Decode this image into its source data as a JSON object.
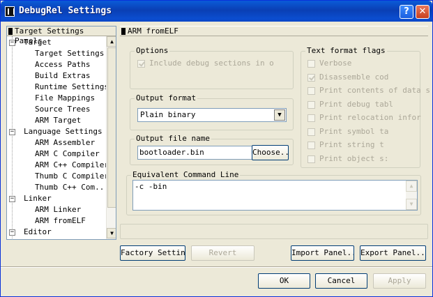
{
  "window": {
    "title": "DebugRel Settings"
  },
  "titlebar": {
    "help": "?",
    "close": "✕"
  },
  "tree": {
    "header": "Target Settings Panels",
    "items": [
      {
        "label": "Target",
        "level": 0,
        "expander": "−"
      },
      {
        "label": "Target Settings",
        "level": 1
      },
      {
        "label": "Access Paths",
        "level": 1
      },
      {
        "label": "Build Extras",
        "level": 1
      },
      {
        "label": "Runtime Settings",
        "level": 1
      },
      {
        "label": "File Mappings",
        "level": 1
      },
      {
        "label": "Source Trees",
        "level": 1
      },
      {
        "label": "ARM Target",
        "level": 1
      },
      {
        "label": "Language Settings",
        "level": 0,
        "expander": "−"
      },
      {
        "label": "ARM Assembler",
        "level": 1
      },
      {
        "label": "ARM C Compiler",
        "level": 1
      },
      {
        "label": "ARM C++ Compiler",
        "level": 1
      },
      {
        "label": "Thumb C Compiler",
        "level": 1
      },
      {
        "label": "Thumb C++ Com...",
        "level": 1
      },
      {
        "label": "Linker",
        "level": 0,
        "expander": "−"
      },
      {
        "label": "ARM Linker",
        "level": 1
      },
      {
        "label": "ARM fromELF",
        "level": 1
      },
      {
        "label": "Editor",
        "level": 0,
        "expander": "−"
      }
    ]
  },
  "panel": {
    "title": "ARM fromELF",
    "options": {
      "label": "Options",
      "include_debug": {
        "label": "Include debug sections in o",
        "checked": true
      }
    },
    "output_format": {
      "label": "Output format",
      "value": "Plain binary"
    },
    "output_file": {
      "label": "Output file name",
      "value": "bootloader.bin",
      "choose_label": "Choose..."
    },
    "text_flags": {
      "label": "Text format flags",
      "items": [
        {
          "label": "Verbose",
          "checked": false
        },
        {
          "label": "Disassemble cod",
          "checked": true
        },
        {
          "label": "Print contents of data s",
          "checked": false
        },
        {
          "label": "Print debug tabl",
          "checked": false
        },
        {
          "label": "Print relocation infor",
          "checked": false
        },
        {
          "label": "Print symbol ta",
          "checked": false
        },
        {
          "label": "Print string t",
          "checked": false
        },
        {
          "label": "Print object s:",
          "checked": false
        }
      ]
    },
    "command_line": {
      "label": "Equivalent Command Line",
      "value": "-c -bin"
    }
  },
  "buttons": {
    "factory": "Factory Settings",
    "revert": "Revert",
    "import": "Import Panel...",
    "export": "Export Panel...",
    "ok": "OK",
    "cancel": "Cancel",
    "apply": "Apply"
  }
}
